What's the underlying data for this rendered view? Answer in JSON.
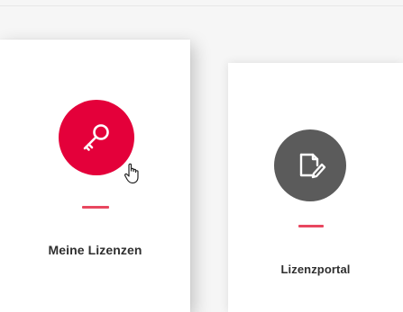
{
  "cards": [
    {
      "label": "Meine Lizenzen",
      "icon": "key-icon",
      "circle_color": "#e4003a",
      "accent_color": "#e8475f"
    },
    {
      "label": "Lizenzportal",
      "icon": "document-edit-icon",
      "circle_color": "#5b5b5b",
      "accent_color": "#e8475f"
    }
  ],
  "cursor": "hand-pointer-icon"
}
